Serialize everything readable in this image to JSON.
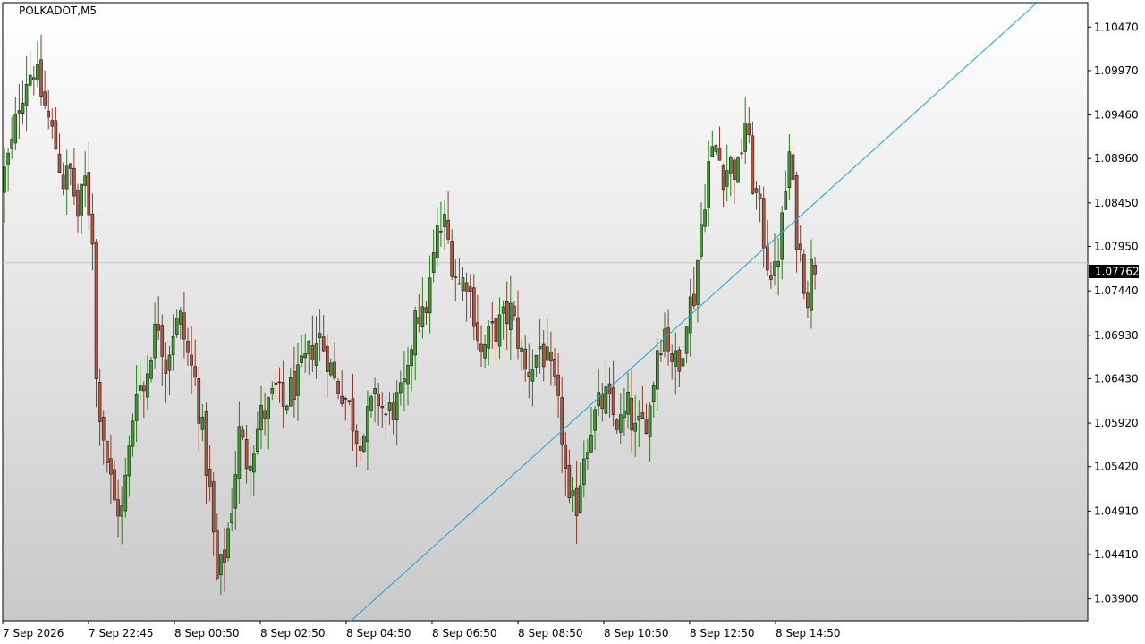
{
  "symbol_label": "POLKADOT,M5",
  "colors": {
    "bull": "#2a7d1b",
    "bear": "#8a3a2a",
    "trendline": "#1fa3d9",
    "bid_line": "#c8c8c8",
    "price_tag_bg": "#000000",
    "background_top": "#ffffff",
    "background_bottom": "#c9c9c9"
  },
  "chart_data": {
    "type": "candlestick",
    "title": "POLKADOT,M5",
    "timeframe": "M5",
    "ylim": [
      1.0365,
      1.1075
    ],
    "y_ticks": [
      "1.10470",
      "1.09970",
      "1.09460",
      "1.08960",
      "1.08450",
      "1.07950",
      "1.07440",
      "1.06930",
      "1.06430",
      "1.05920",
      "1.05420",
      "1.04910",
      "1.04410",
      "1.03900"
    ],
    "x_ticks": [
      "7 Sep 2026",
      "7 Sep 22:45",
      "8 Sep 00:50",
      "8 Sep 02:50",
      "8 Sep 04:50",
      "8 Sep 06:50",
      "8 Sep 08:50",
      "8 Sep 10:50",
      "8 Sep 12:50",
      "8 Sep 14:50"
    ],
    "current_price": "1.07762",
    "current_price_value": 1.07762,
    "grid": false,
    "trendline": {
      "start": {
        "bar": 95.0,
        "price": 1.0365
      },
      "end": {
        "bar": 282.0,
        "price": 1.1075
      }
    },
    "close_path": [
      [
        0,
        1.088
      ],
      [
        2,
        1.091
      ],
      [
        4,
        1.096
      ],
      [
        6,
        1.099
      ],
      [
        8,
        1.1
      ],
      [
        10,
        1.097
      ],
      [
        12,
        1.094
      ],
      [
        14,
        1.091
      ],
      [
        16,
        1.087
      ],
      [
        18,
        1.088
      ],
      [
        20,
        1.083
      ],
      [
        22,
        1.087
      ],
      [
        24,
        1.081
      ],
      [
        25,
        1.064
      ],
      [
        26,
        1.061
      ],
      [
        28,
        1.055
      ],
      [
        30,
        1.05
      ],
      [
        32,
        1.049
      ],
      [
        34,
        1.056
      ],
      [
        36,
        1.064
      ],
      [
        38,
        1.063
      ],
      [
        40,
        1.068
      ],
      [
        42,
        1.071
      ],
      [
        44,
        1.066
      ],
      [
        46,
        1.07
      ],
      [
        48,
        1.071
      ],
      [
        50,
        1.067
      ],
      [
        52,
        1.064
      ],
      [
        54,
        1.058
      ],
      [
        56,
        1.051
      ],
      [
        58,
        1.041
      ],
      [
        60,
        1.044
      ],
      [
        62,
        1.05
      ],
      [
        64,
        1.058
      ],
      [
        66,
        1.055
      ],
      [
        68,
        1.057
      ],
      [
        70,
        1.06
      ],
      [
        72,
        1.061
      ],
      [
        74,
        1.063
      ],
      [
        76,
        1.061
      ],
      [
        78,
        1.063
      ],
      [
        80,
        1.064
      ],
      [
        82,
        1.066
      ],
      [
        84,
        1.068
      ],
      [
        86,
        1.069
      ],
      [
        88,
        1.067
      ],
      [
        90,
        1.064
      ],
      [
        92,
        1.063
      ],
      [
        94,
        1.061
      ],
      [
        96,
        1.058
      ],
      [
        98,
        1.058
      ],
      [
        100,
        1.061
      ],
      [
        102,
        1.062
      ],
      [
        104,
        1.06
      ],
      [
        106,
        1.061
      ],
      [
        108,
        1.062
      ],
      [
        110,
        1.064
      ],
      [
        112,
        1.073
      ],
      [
        114,
        1.071
      ],
      [
        116,
        1.075
      ],
      [
        118,
        1.081
      ],
      [
        120,
        1.082
      ],
      [
        122,
        1.078
      ],
      [
        124,
        1.075
      ],
      [
        126,
        1.076
      ],
      [
        128,
        1.072
      ],
      [
        130,
        1.067
      ],
      [
        132,
        1.069
      ],
      [
        134,
        1.07
      ],
      [
        136,
        1.071
      ],
      [
        138,
        1.072
      ],
      [
        140,
        1.069
      ],
      [
        142,
        1.065
      ],
      [
        144,
        1.066
      ],
      [
        146,
        1.068
      ],
      [
        148,
        1.066
      ],
      [
        150,
        1.063
      ],
      [
        152,
        1.058
      ],
      [
        154,
        1.049
      ],
      [
        156,
        1.05
      ],
      [
        158,
        1.056
      ],
      [
        160,
        1.059
      ],
      [
        162,
        1.061
      ],
      [
        164,
        1.062
      ],
      [
        166,
        1.06
      ],
      [
        168,
        1.059
      ],
      [
        170,
        1.061
      ],
      [
        172,
        1.058
      ],
      [
        174,
        1.059
      ],
      [
        176,
        1.061
      ],
      [
        178,
        1.068
      ],
      [
        180,
        1.07
      ],
      [
        182,
        1.067
      ],
      [
        184,
        1.065
      ],
      [
        186,
        1.072
      ],
      [
        188,
        1.074
      ],
      [
        190,
        1.082
      ],
      [
        192,
        1.089
      ],
      [
        194,
        1.091
      ],
      [
        196,
        1.088
      ],
      [
        198,
        1.089
      ],
      [
        200,
        1.088
      ],
      [
        202,
        1.094
      ],
      [
        204,
        1.087
      ],
      [
        206,
        1.083
      ],
      [
        208,
        1.078
      ],
      [
        210,
        1.076
      ],
      [
        212,
        1.082
      ],
      [
        214,
        1.09
      ],
      [
        216,
        1.081
      ],
      [
        218,
        1.076
      ],
      [
        219,
        1.074
      ],
      [
        220,
        1.077
      ],
      [
        221,
        1.0776
      ]
    ]
  }
}
